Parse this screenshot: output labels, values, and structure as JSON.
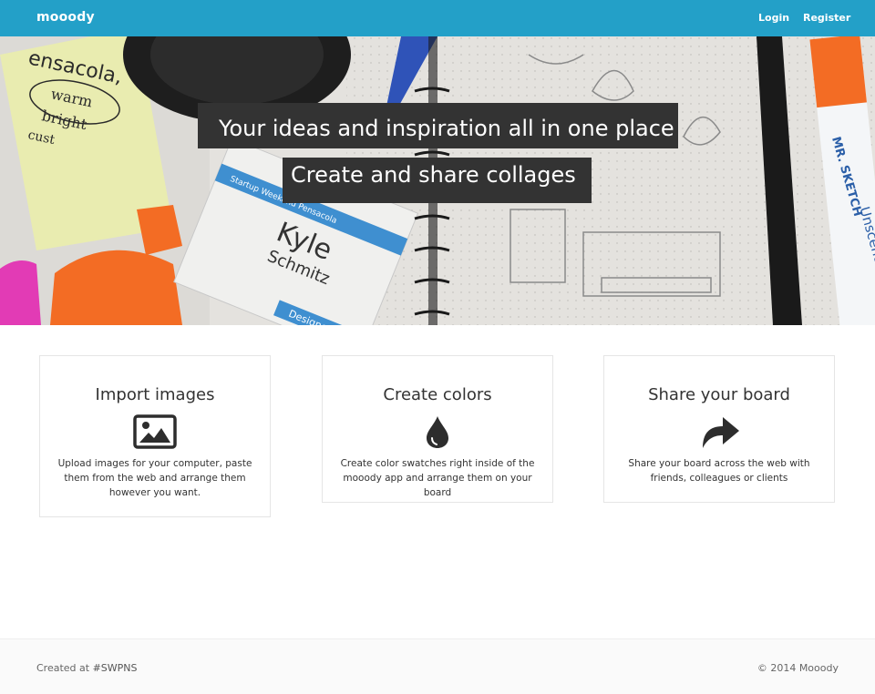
{
  "navbar": {
    "brand": "mooody",
    "login": "Login",
    "register": "Register",
    "background_color": "#23a0c8"
  },
  "hero": {
    "headline_1": "Your ideas and inspiration all in one place",
    "headline_2": "Create and share collages",
    "background_image_handwriting": [
      "ensacola,",
      "warm",
      "bright",
      "cust"
    ],
    "name_tag": {
      "top_line": "Startup Weekend Pensacola",
      "name_first": "Kyle",
      "name_last": "Schmitz",
      "role": "Designer"
    },
    "marker_brand": "MR. SKETCH",
    "marker_label": "Unscented"
  },
  "features": [
    {
      "title": "Import images",
      "icon": "image-icon",
      "description": "Upload images for your computer, paste them from the web and arrange them however you want."
    },
    {
      "title": "Create colors",
      "icon": "droplet-icon",
      "description": "Create color swatches right inside of the mooody app and arrange them on your board"
    },
    {
      "title": "Share your board",
      "icon": "share-arrow-icon",
      "description": "Share your board across the web with friends, colleagues or clients"
    }
  ],
  "footer": {
    "created_prefix": "Created at ",
    "created_tag": "#SWPNS",
    "copyright": "© 2014 Mooody"
  }
}
